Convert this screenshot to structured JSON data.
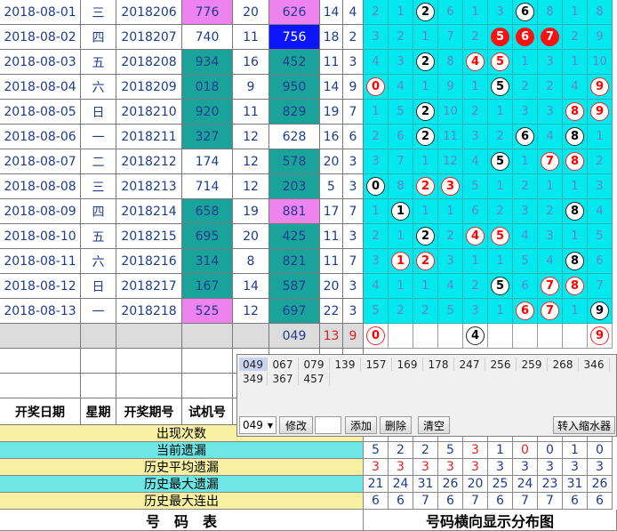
{
  "rows": [
    {
      "date": "2018-08-01",
      "week": "三",
      "issue": "2018206",
      "test": "776",
      "n2": "20",
      "draw": "626",
      "sum": "14",
      "span": "4",
      "tcolor": "mag",
      "dcolor": "mag",
      "dist": [
        "2",
        "1",
        "(2)",
        "6",
        "1",
        "3",
        "(6)",
        "8",
        "1",
        "8"
      ]
    },
    {
      "date": "2018-08-02",
      "week": "四",
      "issue": "2018207",
      "test": "740",
      "n2": "11",
      "draw": "756",
      "sum": "18",
      "span": "2",
      "tcolor": "none",
      "dcolor": "blu",
      "dist": [
        "3",
        "2",
        "1",
        "7",
        "2",
        "[5]",
        "[6]",
        "[7]",
        "2",
        "9"
      ]
    },
    {
      "date": "2018-08-03",
      "week": "五",
      "issue": "2018208",
      "test": "934",
      "n2": "16",
      "draw": "452",
      "sum": "11",
      "span": "3",
      "tcolor": "tea",
      "dcolor": "tea",
      "dist": [
        "4",
        "3",
        "(2)",
        "8",
        "{4}",
        "{5}",
        "1",
        "3",
        "1",
        "10"
      ]
    },
    {
      "date": "2018-08-04",
      "week": "六",
      "issue": "2018209",
      "test": "018",
      "n2": "9",
      "draw": "950",
      "sum": "14",
      "span": "9",
      "tcolor": "tea",
      "dcolor": "tea",
      "dist": [
        "{0}",
        "4",
        "1",
        "9",
        "1",
        "(5)",
        "2",
        "2",
        "4",
        "{9}"
      ]
    },
    {
      "date": "2018-08-05",
      "week": "日",
      "issue": "2018210",
      "test": "920",
      "n2": "11",
      "draw": "829",
      "sum": "19",
      "span": "7",
      "tcolor": "tea",
      "dcolor": "tea",
      "dist": [
        "1",
        "5",
        "(2)",
        "10",
        "2",
        "1",
        "3",
        "3",
        "{8}",
        "{9}"
      ]
    },
    {
      "date": "2018-08-06",
      "week": "一",
      "issue": "2018211",
      "test": "327",
      "n2": "12",
      "draw": "628",
      "sum": "16",
      "span": "6",
      "tcolor": "tea",
      "dcolor": "none",
      "dist": [
        "2",
        "6",
        "(2)",
        "11",
        "3",
        "2",
        "(6)",
        "4",
        "(8)",
        "1"
      ]
    },
    {
      "date": "2018-08-07",
      "week": "二",
      "issue": "2018212",
      "test": "174",
      "n2": "12",
      "draw": "578",
      "sum": "20",
      "span": "3",
      "tcolor": "none",
      "dcolor": "tea",
      "dist": [
        "3",
        "7",
        "1",
        "12",
        "4",
        "(5)",
        "1",
        "{7}",
        "{8}",
        "2"
      ]
    },
    {
      "date": "2018-08-08",
      "week": "三",
      "issue": "2018213",
      "test": "714",
      "n2": "12",
      "draw": "203",
      "sum": "5",
      "span": "3",
      "tcolor": "none",
      "dcolor": "tea",
      "dist": [
        "(0)",
        "8",
        "{2}",
        "{3}",
        "5",
        "1",
        "2",
        "1",
        "1",
        "3"
      ]
    },
    {
      "date": "2018-08-09",
      "week": "四",
      "issue": "2018214",
      "test": "658",
      "n2": "19",
      "draw": "881",
      "sum": "17",
      "span": "7",
      "tcolor": "tea",
      "dcolor": "mag",
      "dist": [
        "1",
        "(1)",
        "1",
        "1",
        "6",
        "2",
        "3",
        "2",
        "(8)",
        "4"
      ]
    },
    {
      "date": "2018-08-10",
      "week": "五",
      "issue": "2018215",
      "test": "695",
      "n2": "20",
      "draw": "425",
      "sum": "11",
      "span": "3",
      "tcolor": "tea",
      "dcolor": "tea",
      "dist": [
        "2",
        "1",
        "(2)",
        "2",
        "{4}",
        "{5}",
        "4",
        "3",
        "1",
        "5"
      ]
    },
    {
      "date": "2018-08-11",
      "week": "六",
      "issue": "2018216",
      "test": "314",
      "n2": "8",
      "draw": "821",
      "sum": "11",
      "span": "7",
      "tcolor": "tea",
      "dcolor": "tea",
      "dist": [
        "3",
        "{1}",
        "{2}",
        "3",
        "1",
        "1",
        "5",
        "4",
        "(8)",
        "6"
      ]
    },
    {
      "date": "2018-08-12",
      "week": "日",
      "issue": "2018217",
      "test": "167",
      "n2": "14",
      "draw": "587",
      "sum": "20",
      "span": "3",
      "tcolor": "tea",
      "dcolor": "tea",
      "dist": [
        "4",
        "1",
        "1",
        "4",
        "2",
        "(5)",
        "6",
        "{7}",
        "{8}",
        "7"
      ]
    },
    {
      "date": "2018-08-13",
      "week": "一",
      "issue": "2018218",
      "test": "525",
      "n2": "12",
      "draw": "697",
      "sum": "22",
      "span": "3",
      "tcolor": "mag",
      "dcolor": "tea",
      "dist": [
        "5",
        "2",
        "2",
        "5",
        "3",
        "1",
        "{6}",
        "{7}",
        "1",
        "(9)"
      ]
    }
  ],
  "summary_row": {
    "draw": "049",
    "sum": "13",
    "span": "9",
    "dist": [
      "{0}",
      "",
      "",
      "",
      "(4)",
      "",
      "",
      "",
      "",
      "{9}"
    ]
  },
  "headers": {
    "date": "开奖日期",
    "week": "星期",
    "issue": "开奖期号",
    "test": "试机号"
  },
  "stats": [
    {
      "label": "出现次数",
      "values": []
    },
    {
      "label": "当前遗漏",
      "values": [
        "5",
        "2",
        "2",
        "5",
        "3",
        "1",
        "0",
        "0",
        "1",
        "0"
      ]
    },
    {
      "label": "历史平均遗漏",
      "values": [
        "3",
        "3",
        "3",
        "3",
        "3",
        "3",
        "3",
        "3",
        "3",
        "3"
      ]
    },
    {
      "label": "历史最大遗漏",
      "values": [
        "21",
        "24",
        "31",
        "26",
        "20",
        "25",
        "24",
        "23",
        "31",
        "26"
      ]
    },
    {
      "label": "历史最大连出",
      "values": [
        "6",
        "6",
        "7",
        "6",
        "7",
        "6",
        "7",
        "7",
        "6",
        "6"
      ]
    }
  ],
  "footer": {
    "left": "号　码　表",
    "right": "号码横向显示分布图"
  },
  "panel": {
    "chips_row1": [
      "049",
      "067",
      "079",
      "139",
      "157",
      "169",
      "178",
      "247",
      "256",
      "259",
      "268",
      "346"
    ],
    "chips_row2": [
      "349",
      "367",
      "457"
    ],
    "select_value": "049",
    "btn_modify": "修改",
    "btn_add": "添加",
    "btn_delete": "删除",
    "btn_clear": "清空",
    "btn_transfer": "转入缩水器"
  }
}
